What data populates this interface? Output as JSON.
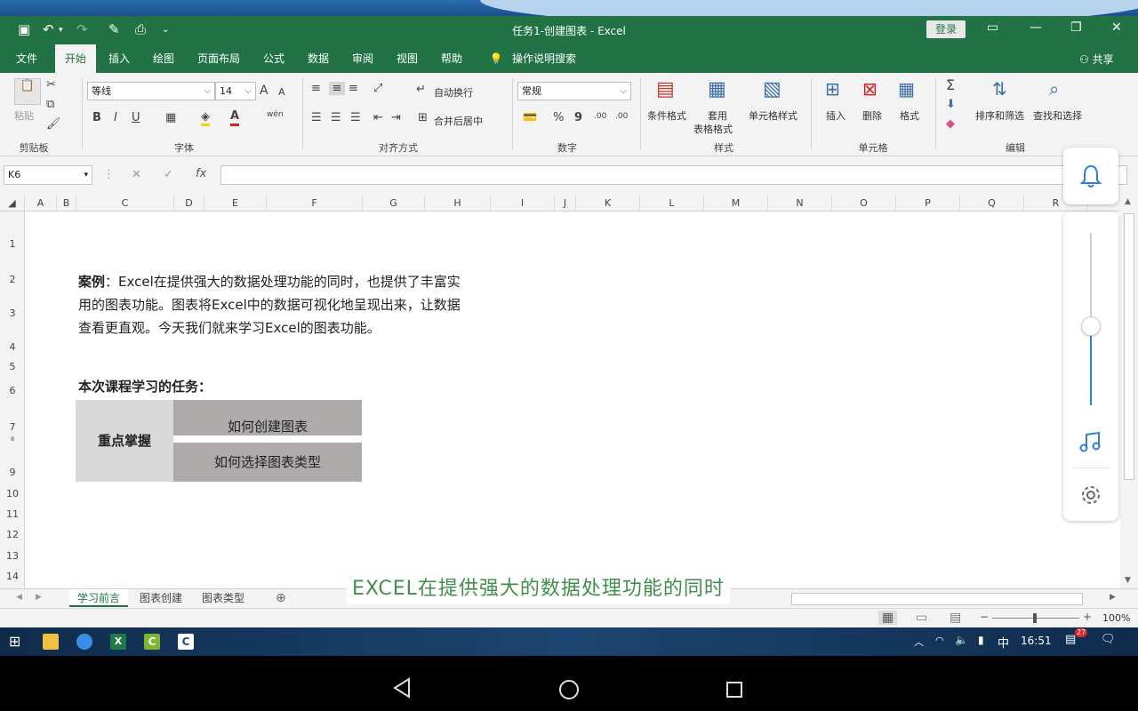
{
  "window": {
    "title": "任务1-创建图表  -  Excel",
    "login_label": "登录",
    "share_label": "共享"
  },
  "tabs": [
    {
      "label": "文件"
    },
    {
      "label": "开始"
    },
    {
      "label": "插入"
    },
    {
      "label": "绘图"
    },
    {
      "label": "页面布局"
    },
    {
      "label": "公式"
    },
    {
      "label": "数据"
    },
    {
      "label": "审阅"
    },
    {
      "label": "视图"
    },
    {
      "label": "帮助"
    },
    {
      "label": "操作说明搜索"
    }
  ],
  "ribbon": {
    "clipboard": {
      "paste": "粘贴",
      "group": "剪贴板"
    },
    "font": {
      "family": "等线",
      "size": "14",
      "bold": "B",
      "italic": "I",
      "underline": "U",
      "grow": "A",
      "shrink": "A",
      "font_color": "A",
      "wen": "wén",
      "group": "字体"
    },
    "alignment": {
      "wrap": "自动换行",
      "merge": "合并后居中",
      "group": "对齐方式"
    },
    "number": {
      "format": "常规",
      "percent": "%",
      "comma": "9",
      "inc": ".00",
      "dec": ".00",
      "group": "数字"
    },
    "styles": {
      "conditional": "条件格式",
      "table_line1": "套用",
      "table_line2": "表格格式",
      "cell_styles": "单元格样式",
      "group": "样式"
    },
    "cells": {
      "insert": "插入",
      "delete": "删除",
      "format": "格式",
      "group": "单元格"
    },
    "editing": {
      "sum": "Σ",
      "sort": "排序和筛选",
      "find": "查找和选择",
      "group": "编辑"
    }
  },
  "formula_bar": {
    "name_box": "K6",
    "fx": "fx",
    "value": ""
  },
  "columns": [
    "A",
    "B",
    "C",
    "D",
    "E",
    "F",
    "G",
    "H",
    "I",
    "J",
    "K",
    "L",
    "M",
    "N",
    "O",
    "P",
    "Q",
    "R"
  ],
  "rows": [
    "1",
    "2",
    "3",
    "4",
    "5",
    "6",
    "7",
    "8",
    "9",
    "10",
    "11",
    "12",
    "13",
    "14"
  ],
  "content": {
    "case_label": "案例",
    "line1": "：Excel在提供强大的数据处理功能的同时，也提供了丰富实",
    "line2": "用的图表功能。图表将Excel中的数据可视化地呈现出来，让数据",
    "line3": "查看更直观。今天我们就来学习Excel的图表功能。",
    "task_title": "本次课程学习的任务：",
    "key_label": "重点掌握",
    "task1": "如何创建图表",
    "task2": "如何选择图表类型"
  },
  "sheet_tabs": [
    {
      "label": "学习前言"
    },
    {
      "label": "图表创建"
    },
    {
      "label": "图表类型"
    }
  ],
  "subtitle": "EXCEL在提供强大的数据处理功能的同时",
  "status": {
    "zoom": "100%"
  },
  "taskbar": {
    "ime": "中",
    "clock": "16:51",
    "badge": "27"
  }
}
